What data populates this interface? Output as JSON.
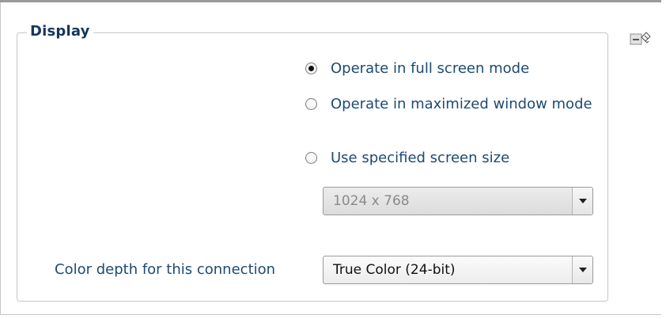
{
  "group": {
    "title": "Display"
  },
  "display_mode": {
    "options": [
      {
        "label": "Operate in full screen mode",
        "selected": true
      },
      {
        "label": "Operate in maximized window mode",
        "selected": false
      },
      {
        "label": "Use specified screen size",
        "selected": false
      }
    ]
  },
  "screen_size": {
    "value": "1024 x 768",
    "enabled": false
  },
  "color_depth": {
    "label": "Color depth for this connection",
    "value": "True Color (24-bit)"
  },
  "icons": {
    "collapse": "collapse-section-icon",
    "dropdown": "chevron-down-icon"
  },
  "colors": {
    "label_text": "#1d4a73",
    "legend_text": "#16365c",
    "border": "#c6c6c6"
  }
}
